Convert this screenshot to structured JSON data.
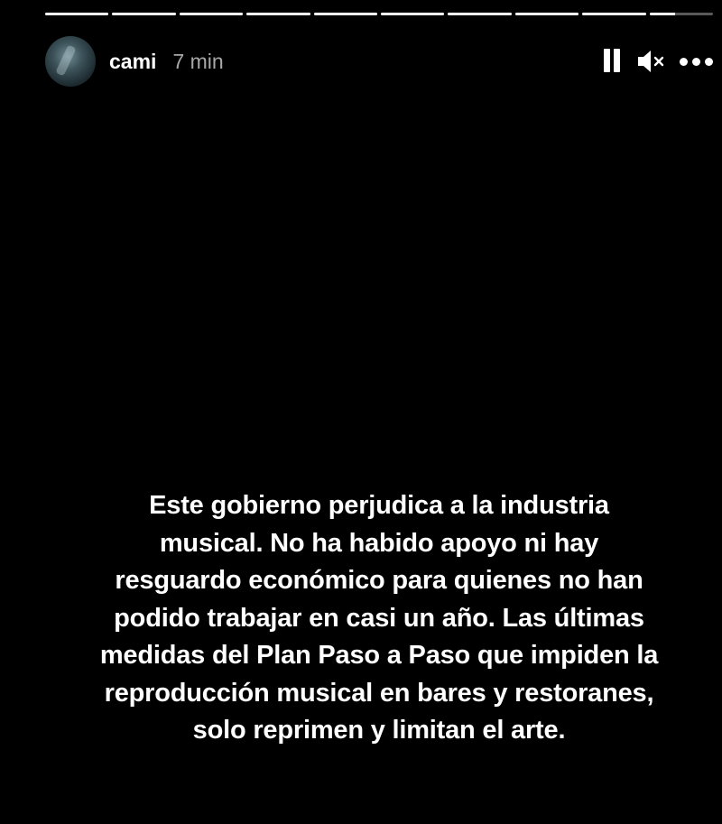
{
  "story": {
    "progress_segments": [
      1,
      1,
      1,
      1,
      1,
      1,
      1,
      1,
      1,
      0.4
    ],
    "user": {
      "username": "cami",
      "time": "7 min"
    },
    "controls": {
      "pause": "pause-icon",
      "mute": "speaker-muted-icon",
      "more": "more-options-icon"
    },
    "caption": "Este gobierno perjudica a la industria\nmusical. No ha habido apoyo ni hay\nresguardo económico para quienes no han\npodido trabajar en casi un año. Las últimas\nmedidas del Plan Paso a Paso que impiden la\nreproducción musical en bares y restoranes,\nsolo reprimen y limitan el arte."
  },
  "colors": {
    "background": "#000000",
    "text": "#ffffff",
    "muted_text": "#a8a8a8",
    "progress_track": "rgba(255,255,255,0.35)",
    "progress_fill": "#ffffff"
  }
}
